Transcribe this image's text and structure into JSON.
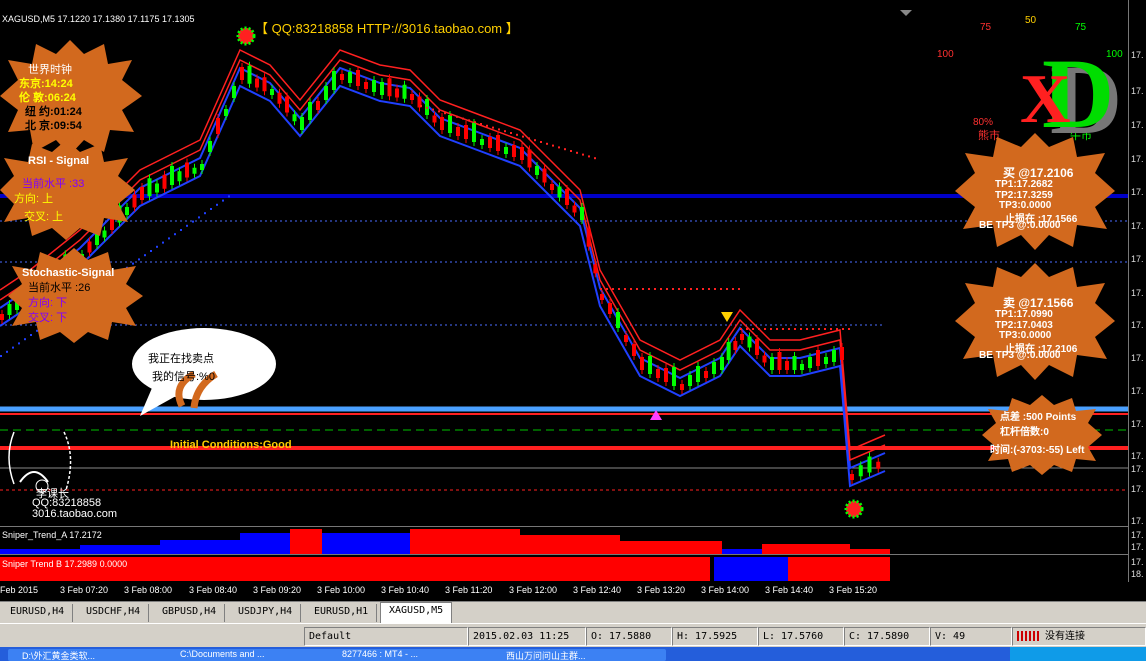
{
  "chart": {
    "symbol_line": "XAGUSD,M5  17.1220 17.1380 17.1175 17.1305",
    "ad_text": "【 QQ:83218858 HTTP://3016.taobao.com 】",
    "initial_conditions": "Initial Conditions:Good",
    "top_numbers": [
      "75",
      "50",
      "75",
      "100",
      "100",
      "80%"
    ],
    "bull_label": "牛市",
    "bear_label": "熊市",
    "logo_letter": "D"
  },
  "world_clock": {
    "title": "世界时钟",
    "tokyo": "东京:14:24",
    "london": "伦 敦:06:24",
    "newyork": "纽 约:01:24",
    "beijing": "北 京:09:54"
  },
  "rsi": {
    "title": "RSI - Signal",
    "level": "当前水平 :33",
    "direction": "方向: 上",
    "cross": "交叉: 上"
  },
  "stoch": {
    "title": "Stochastic-Signal",
    "level": "当前水平 :26",
    "direction": "方向: 下",
    "cross": "交叉: 下"
  },
  "bubble": {
    "line1": "我正在找卖点",
    "line2": "我的信号:%0"
  },
  "watermark": {
    "name": "李课长",
    "qq": "QQ:83218858",
    "site": "3016.taobao.com"
  },
  "buy_box": {
    "title": "买 @17.2106",
    "tp1": "TP1:17.2682",
    "tp2": "TP2:17.3259",
    "tp3": "TP3:0.0000",
    "stop": "止损在 :17.1566",
    "be": "BE TP3 @:0.0000"
  },
  "sell_box": {
    "title": "卖 @17.1566",
    "tp1": "TP1:17.0990",
    "tp2": "TP2:17.0403",
    "tp3": "TP3:0.0000",
    "stop": "止损在 :17.2106",
    "be": "BE TP3 @:0.0000"
  },
  "spread_box": {
    "spread": "点差 :500 Points",
    "leverage": "杠杆倍数:0",
    "time_left": "时间:(-3703:-55) Left"
  },
  "price_axis": [
    "17.",
    "17.",
    "17.",
    "17.",
    "17.",
    "17.",
    "17.",
    "17.",
    "17.",
    "17.",
    "17.",
    "17.",
    "17.",
    "17.",
    "17.",
    "17."
  ],
  "sub_indicator_a": "Sniper_Trend_A 17.2172",
  "sub_indicator_b": "Sniper Trend B 17.2989 0.0000",
  "sub_axis": [
    "17.",
    "17.",
    "17.",
    "18.",
    "17."
  ],
  "time_axis": [
    "Feb 2015",
    "3 Feb 07:20",
    "3 Feb 08:00",
    "3 Feb 08:40",
    "3 Feb 09:20",
    "3 Feb 10:00",
    "3 Feb 10:40",
    "3 Feb 11:20",
    "3 Feb 12:00",
    "3 Feb 12:40",
    "3 Feb 13:20",
    "3 Feb 14:00",
    "3 Feb 14:40",
    "3 Feb 15:20"
  ],
  "tabs": [
    "EURUSD,H4",
    "USDCHF,H4",
    "GBPUSD,H4",
    "USDJPY,H4",
    "EURUSD,H1",
    "XAGUSD,M5"
  ],
  "active_tab": "XAGUSD,M5",
  "status": {
    "profile": "Default",
    "datetime": "2015.02.03 11:25",
    "open": "O: 17.5880",
    "high": "H: 17.5925",
    "low": "L: 17.5760",
    "close": "C: 17.5890",
    "volume": "V: 49",
    "connection": "没有连接"
  },
  "taskbar": [
    "D:\\外汇黄金类软...",
    "C:\\Documents and ...",
    "8277466 : MT4 - ...",
    "西山万问问山主群..."
  ],
  "colors": {
    "bull": "#00ff00",
    "bear": "#ff0000",
    "blob": "#d2691e",
    "band_blue": "#1e3cff"
  }
}
